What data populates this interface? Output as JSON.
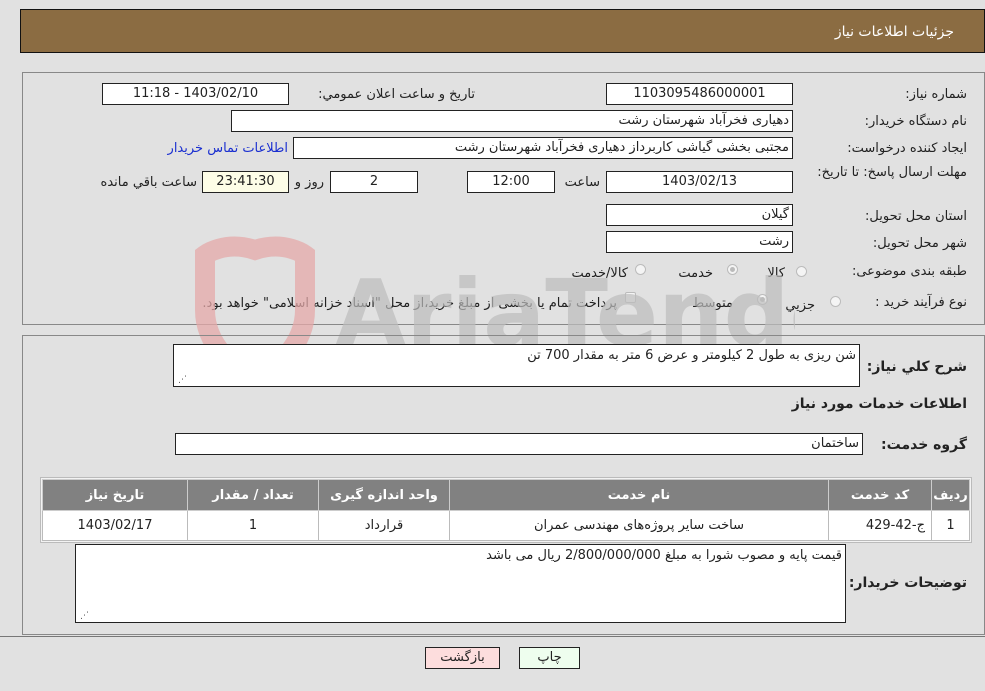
{
  "header": {
    "title": "جزئيات اطلاعات نياز"
  },
  "fields": {
    "need_number_label": "شماره نياز:",
    "need_number": "1103095486000001",
    "announce_label": "تاريخ و ساعت اعلان عمومي:",
    "announce_value": "1403/02/10 - 11:18",
    "buyer_org_label": "نام دستگاه خريدار:",
    "buyer_org": "دهیاری فخرآباد شهرستان رشت",
    "creator_label": "ايجاد کننده درخواست:",
    "creator": "مجتبی بخشی گیاشی کاربرداز دهیاری فخرآباد شهرستان رشت",
    "contact_link": "اطلاعات تماس خريدار",
    "deadline_label": "مهلت ارسال پاسخ: تا تاريخ:",
    "deadline_date": "1403/02/13",
    "time_label": "ساعت",
    "deadline_time": "12:00",
    "days_value": "2",
    "days_label": "روز و",
    "remaining_time": "23:41:30",
    "remaining_label": "ساعت باقي مانده",
    "province_label": "استان محل تحويل:",
    "province": "گیلان",
    "city_label": "شهر محل تحويل:",
    "city": "رشت",
    "category_label": "طبقه بندی موضوعی:",
    "category_options": [
      {
        "label": "کالا",
        "selected": false
      },
      {
        "label": "خدمت",
        "selected": true
      },
      {
        "label": "کالا/خدمت",
        "selected": false
      }
    ],
    "process_label": "نوع فرآيند خريد :",
    "process_options": [
      {
        "label": "جزيي",
        "selected": false
      },
      {
        "label": "متوسط",
        "selected": true
      }
    ],
    "payment_note": "پرداخت تمام يا بخشی از مبلغ خريد،از محل \"اسناد خزانه اسلامی\" خواهد بود.",
    "payment_checked": false
  },
  "details": {
    "summary_label": "شرح کلي نياز:",
    "summary": "شن ریزی به طول 2 کیلومتر و عرض 6 متر به مقدار 700 تن",
    "services_heading": "اطلاعات خدمات مورد نياز",
    "service_group_label": "گروه خدمت:",
    "service_group": "ساختمان",
    "table": {
      "headers": [
        "رديف",
        "کد خدمت",
        "نام خدمت",
        "واحد اندازه گيری",
        "تعداد / مقدار",
        "تاريخ نياز"
      ],
      "rows": [
        [
          "1",
          "ج-42-429",
          "ساخت سایر پروژه‌های مهندسی عمران",
          "قرارداد",
          "1",
          "1403/02/17"
        ]
      ]
    },
    "buyer_notes_label": "توضيحات خريدار:",
    "buyer_notes": "قیمت پایه و مصوب شورا به مبلغ 2/800/000/000 ریال می باشد"
  },
  "buttons": {
    "print": "چاپ",
    "back": "بازگشت"
  },
  "colors": {
    "header_bg": "#8b6c42",
    "print_bg": "#eefeee",
    "back_bg": "#fddddd",
    "table_header_bg": "#818181",
    "link": "#1a2fd0"
  },
  "watermark": {
    "text": "AriaTender.neT"
  }
}
